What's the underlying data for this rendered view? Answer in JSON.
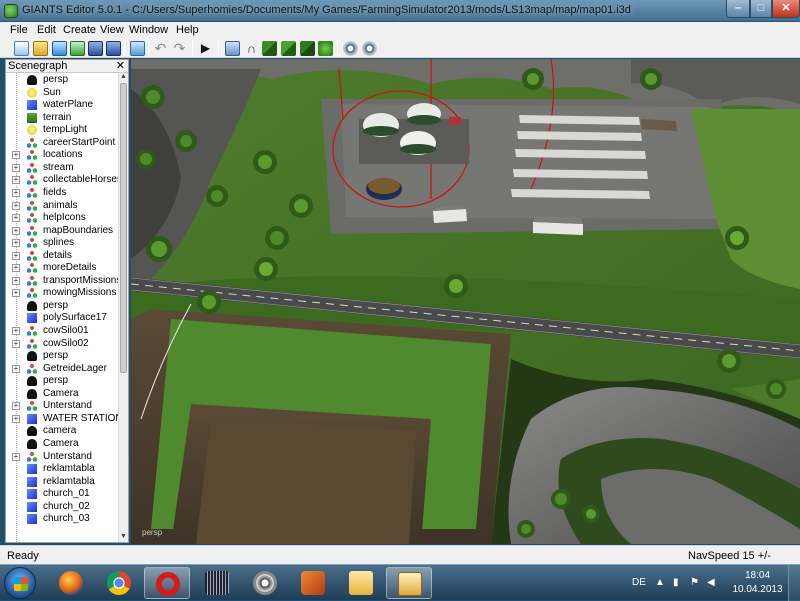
{
  "window": {
    "title": "GIANTS Editor 5.0.1 - C:/Users/Superhomies/Documents/My Games/FarmingSimulator2013/mods/LS13map/map/map01.i3d",
    "min_glyph": "–",
    "max_glyph": "□",
    "close_glyph": "✕"
  },
  "menu": [
    {
      "label": "File"
    },
    {
      "label": "Edit"
    },
    {
      "label": "Create"
    },
    {
      "label": "View"
    },
    {
      "label": "Window"
    },
    {
      "label": "Help"
    }
  ],
  "toolbar_icons": [
    "new-icon",
    "open-icon",
    "import-icon",
    "export-icon",
    "save-icon",
    "save-as-icon",
    "undo-icon",
    "redo-icon",
    "play-icon",
    "house-icon",
    "magnet-icon",
    "terrain-paint-icon",
    "terrain-paint2-icon",
    "terrain-paint3-icon",
    "foliage-icon",
    "settings-icon",
    "settings2-icon"
  ],
  "scenegraph": {
    "title": "Scenegraph",
    "close": "✕",
    "nodes": [
      {
        "label": "persp",
        "icon": "camera",
        "expandable": false
      },
      {
        "label": "Sun",
        "icon": "light",
        "expandable": false
      },
      {
        "label": "waterPlane",
        "icon": "shape",
        "expandable": false
      },
      {
        "label": "terrain",
        "icon": "terrain",
        "expandable": false
      },
      {
        "label": "tempLight",
        "icon": "light",
        "expandable": false
      },
      {
        "label": "careerStartPoint",
        "icon": "transform",
        "expandable": false
      },
      {
        "label": "locations",
        "icon": "transform",
        "expandable": true
      },
      {
        "label": "stream",
        "icon": "transform",
        "expandable": true
      },
      {
        "label": "collectableHorses",
        "icon": "transform",
        "expandable": true
      },
      {
        "label": "fields",
        "icon": "transform",
        "expandable": true
      },
      {
        "label": "animals",
        "icon": "transform",
        "expandable": true
      },
      {
        "label": "helpIcons",
        "icon": "transform",
        "expandable": true
      },
      {
        "label": "mapBoundaries",
        "icon": "transform",
        "expandable": true
      },
      {
        "label": "splines",
        "icon": "transform",
        "expandable": true
      },
      {
        "label": "details",
        "icon": "transform",
        "expandable": true
      },
      {
        "label": "moreDetails",
        "icon": "transform",
        "expandable": true
      },
      {
        "label": "transportMissions",
        "icon": "transform",
        "expandable": true
      },
      {
        "label": "mowingMissions",
        "icon": "transform",
        "expandable": true
      },
      {
        "label": "persp",
        "icon": "camera",
        "expandable": false
      },
      {
        "label": "polySurface17",
        "icon": "shape",
        "expandable": false
      },
      {
        "label": "cowSilo01",
        "icon": "transform",
        "expandable": true
      },
      {
        "label": "cowSilo02",
        "icon": "transform",
        "expandable": true
      },
      {
        "label": "persp",
        "icon": "camera",
        "expandable": false
      },
      {
        "label": "GetreideLager",
        "icon": "transform",
        "expandable": true
      },
      {
        "label": "persp",
        "icon": "camera",
        "expandable": false
      },
      {
        "label": "Camera",
        "icon": "camera",
        "expandable": false
      },
      {
        "label": "Unterstand",
        "icon": "transform",
        "expandable": true
      },
      {
        "label": "WATER STATION",
        "icon": "shape",
        "expandable": true
      },
      {
        "label": "camera",
        "icon": "camera",
        "expandable": false
      },
      {
        "label": "Camera",
        "icon": "camera",
        "expandable": false
      },
      {
        "label": "Unterstand",
        "icon": "transform",
        "expandable": true
      },
      {
        "label": "reklamtabla",
        "icon": "shape",
        "expandable": false
      },
      {
        "label": "reklamtabla",
        "icon": "shape",
        "expandable": false
      },
      {
        "label": "church_01",
        "icon": "shape",
        "expandable": false
      },
      {
        "label": "church_02",
        "icon": "shape",
        "expandable": false
      },
      {
        "label": "church_03",
        "icon": "shape",
        "expandable": false
      }
    ]
  },
  "viewport": {
    "camera_label": "persp"
  },
  "status": {
    "left": "Ready",
    "right": "NavSpeed 15 +/-"
  },
  "taskbar": {
    "apps": [
      "explorer-icon",
      "firefox-icon",
      "chrome-icon",
      "opera-icon",
      "audio-editor-icon",
      "media-icon",
      "video-icon",
      "folder-icon",
      "giants-editor-icon"
    ],
    "language": "DE",
    "time": "18:04",
    "date": "10.04.2013"
  },
  "colors": {
    "accent_red": "#d01010",
    "grass": "#5c8a33",
    "asphalt": "#5a5a5a"
  }
}
